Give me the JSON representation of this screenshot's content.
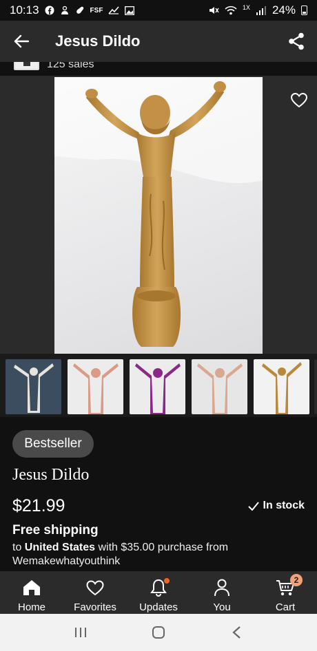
{
  "status_bar": {
    "time": "10:13",
    "notif_icons": [
      "facebook-icon",
      "robot-icon",
      "link-icon",
      "fsf-label",
      "photo-icon"
    ],
    "fsf_label": "FSF",
    "network_label": "1X",
    "battery_text": "24%"
  },
  "app_bar": {
    "title": "Jesus Dildo"
  },
  "seller": {
    "sales_text": "125 sales"
  },
  "gallery": {
    "thumbnail_count": 5,
    "thumbnail_colors": [
      "#e6e4dc",
      "#d99a86",
      "#8a2a86",
      "#d9a892",
      "#b98a3e"
    ],
    "main_color": "#c08f45"
  },
  "product": {
    "badge": "Bestseller",
    "title": "Jesus Dildo",
    "price": "$21.99",
    "stock": "In stock",
    "shipping_title": "Free shipping",
    "shipping_to_prefix": "to ",
    "shipping_country": "United States",
    "shipping_suffix": " with $35.00 purchase from",
    "shop_name": "Wemakewhatyouthink"
  },
  "bottom_nav": {
    "items": [
      {
        "label": "Home",
        "icon": "home-icon"
      },
      {
        "label": "Favorites",
        "icon": "heart-icon"
      },
      {
        "label": "Updates",
        "icon": "bell-icon"
      },
      {
        "label": "You",
        "icon": "person-icon"
      },
      {
        "label": "Cart",
        "icon": "cart-icon"
      }
    ],
    "cart_count": "2"
  },
  "colors": {
    "background": "#111111",
    "bar": "#2b2b2b",
    "accent": "#f1641e",
    "badge_bg": "#4a4a4a"
  }
}
